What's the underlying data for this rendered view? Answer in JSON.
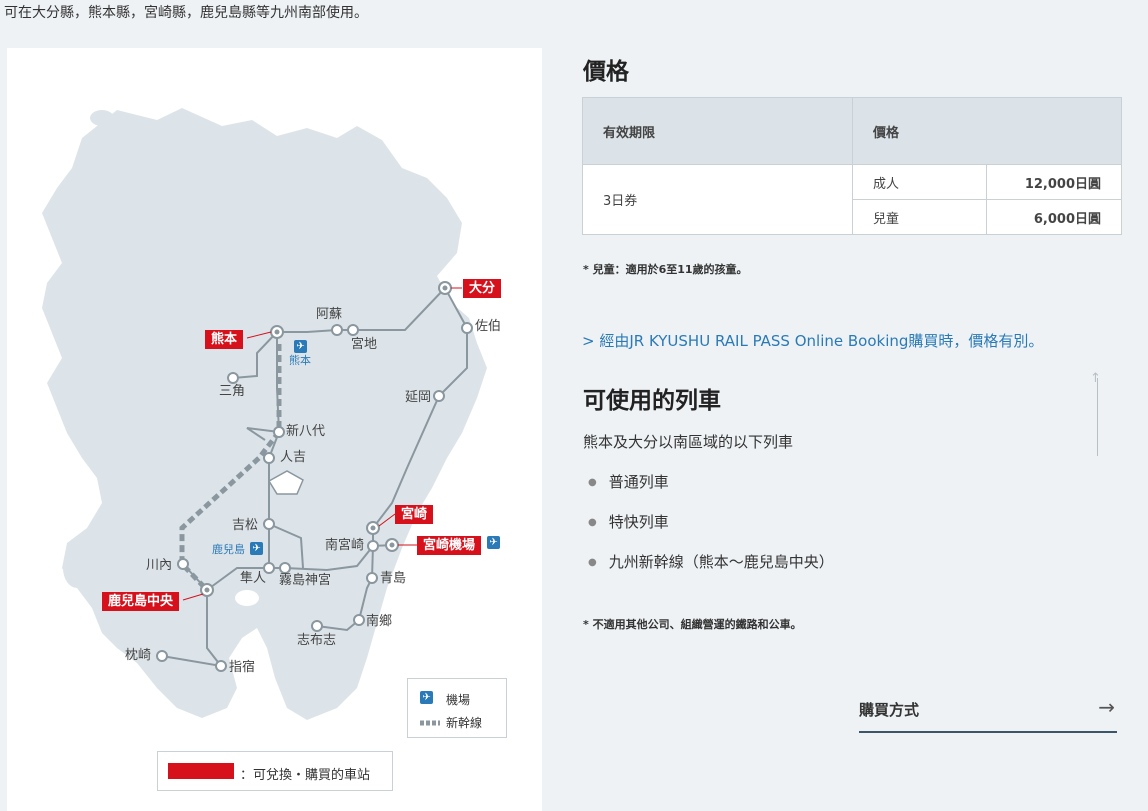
{
  "intro": "可在大分縣，熊本縣，宮崎縣，鹿兒島縣等九州南部使用。",
  "map": {
    "stations": [
      {
        "id": "aso",
        "label": "阿蘇"
      },
      {
        "id": "miyaji",
        "label": "宮地"
      },
      {
        "id": "saiki",
        "label": "佐伯"
      },
      {
        "id": "misumi",
        "label": "三角"
      },
      {
        "id": "shinyatsushiro",
        "label": "新八代"
      },
      {
        "id": "nobeoka",
        "label": "延岡"
      },
      {
        "id": "hitoyoshi",
        "label": "人吉"
      },
      {
        "id": "yoshimatsu",
        "label": "吉松"
      },
      {
        "id": "minamimiyazaki",
        "label": "南宮崎"
      },
      {
        "id": "sendai",
        "label": "川內"
      },
      {
        "id": "hayato",
        "label": "隼人"
      },
      {
        "id": "kirishimajingu",
        "label": "霧島神宮"
      },
      {
        "id": "aoshima",
        "label": "青島"
      },
      {
        "id": "nango",
        "label": "南鄉"
      },
      {
        "id": "shibushi",
        "label": "志布志"
      },
      {
        "id": "makurazaki",
        "label": "枕崎"
      },
      {
        "id": "ibusuki",
        "label": "指宿"
      }
    ],
    "red_stations": {
      "oita": "大分",
      "kumamoto": "熊本",
      "miyazaki": "宮崎",
      "miyazaki_airport": "宮崎機場",
      "kagoshima_chuo": "鹿兒島中央"
    },
    "airports": {
      "kumamoto": "熊本",
      "kagoshima": "鹿兒島"
    },
    "legend": {
      "airport": "機場",
      "shinkansen": "新幹線",
      "red_station_note": "：可兌換・購買的車站"
    },
    "colors": {
      "land": "#dde4e9",
      "rail": "#8a979f",
      "red": "#d7111b",
      "airport": "#2a7ab8"
    }
  },
  "price": {
    "title": "價格",
    "table": {
      "headers": [
        "有效期限",
        "價格"
      ],
      "period": "3日券",
      "rows": [
        {
          "type": "成人",
          "amount": "12,000日圓"
        },
        {
          "type": "兒童",
          "amount": "6,000日圓"
        }
      ]
    },
    "note": "* 兒童：適用於6至11歲的孩童。",
    "link": "> 經由JR KYUSHU RAIL PASS Online Booking購買時，價格有別。"
  },
  "trains": {
    "title": "可使用的列車",
    "intro": "熊本及大分以南區域的以下列車",
    "items": [
      "普通列車",
      "特快列車",
      "九州新幹線（熊本～鹿兒島中央）"
    ],
    "note": "* 不適用其他公司、組織營運的鐵路和公車。"
  },
  "buy": {
    "label": "購買方式"
  }
}
